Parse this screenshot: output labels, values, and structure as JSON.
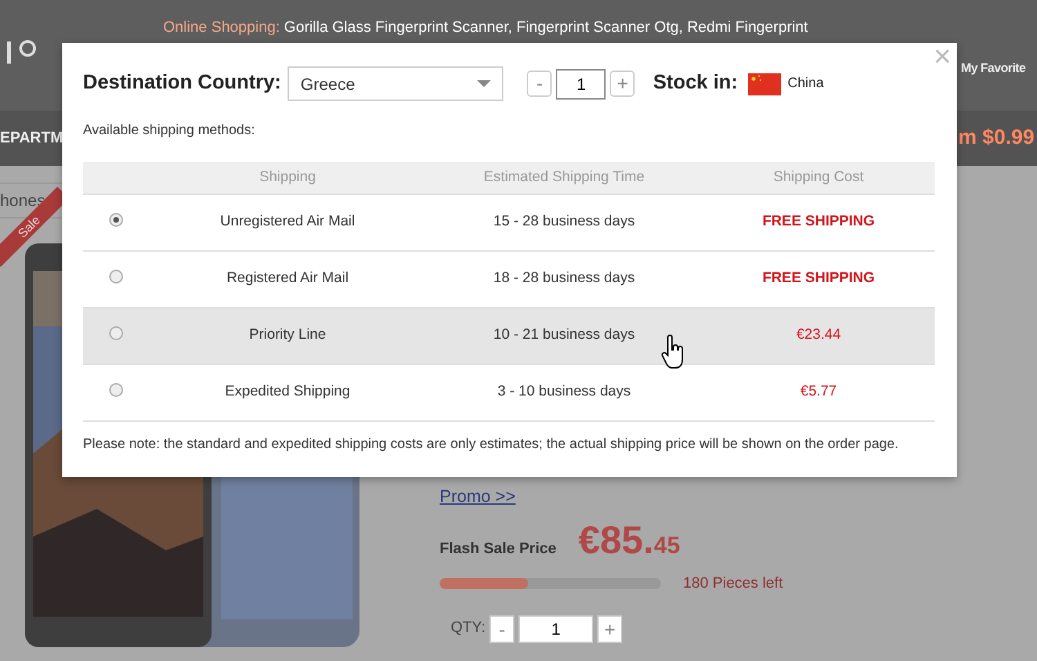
{
  "page": {
    "top_line": {
      "label": "Online Shopping:",
      "links": [
        "Gorilla Glass Fingerprint Scanner,",
        "Fingerprint Scanner Otg,",
        "Redmi Fingerprint"
      ]
    },
    "favorites": "My Favorite",
    "nav_left": "EPARTM",
    "nav_right": "m $0.99",
    "breadcrumb": "hones",
    "ribbon": "Sale",
    "promo_link": "Promo >>",
    "flash_label": "Flash Sale Price",
    "price_main": "€85.",
    "price_cents": "45",
    "stock": {
      "level": 0.4,
      "text": "180 Pieces left"
    },
    "qty": {
      "label": "QTY:",
      "minus": "-",
      "value": "1",
      "plus": "+"
    }
  },
  "dialog": {
    "close": "×",
    "country_label": "Destination Country:",
    "country_value": "Greece",
    "qty_minus": "-",
    "qty_value": "1",
    "qty_plus": "+",
    "stock_label": "Stock in:",
    "stock_country": "China",
    "methods_label": "Available shipping methods:",
    "columns": [
      "Shipping",
      "Estimated Shipping Time",
      "Shipping Cost"
    ],
    "rows": [
      {
        "selected": true,
        "highlighted": false,
        "name": "Unregistered Air Mail",
        "time": "15 - 28 business days",
        "cost": "FREE SHIPPING",
        "kind": "free"
      },
      {
        "selected": false,
        "highlighted": false,
        "name": "Registered Air Mail",
        "time": "18 - 28 business days",
        "cost": "FREE SHIPPING",
        "kind": "free"
      },
      {
        "selected": false,
        "highlighted": true,
        "name": "Priority Line",
        "time": "10 - 21 business days",
        "cost": "€23.44",
        "kind": "price"
      },
      {
        "selected": false,
        "highlighted": false,
        "name": "Expedited Shipping",
        "time": "3 - 10 business days",
        "cost": "€5.77",
        "kind": "price"
      }
    ],
    "note": "Please note: the standard and expedited shipping costs are only estimates; the actual shipping price will be shown on the order page."
  }
}
